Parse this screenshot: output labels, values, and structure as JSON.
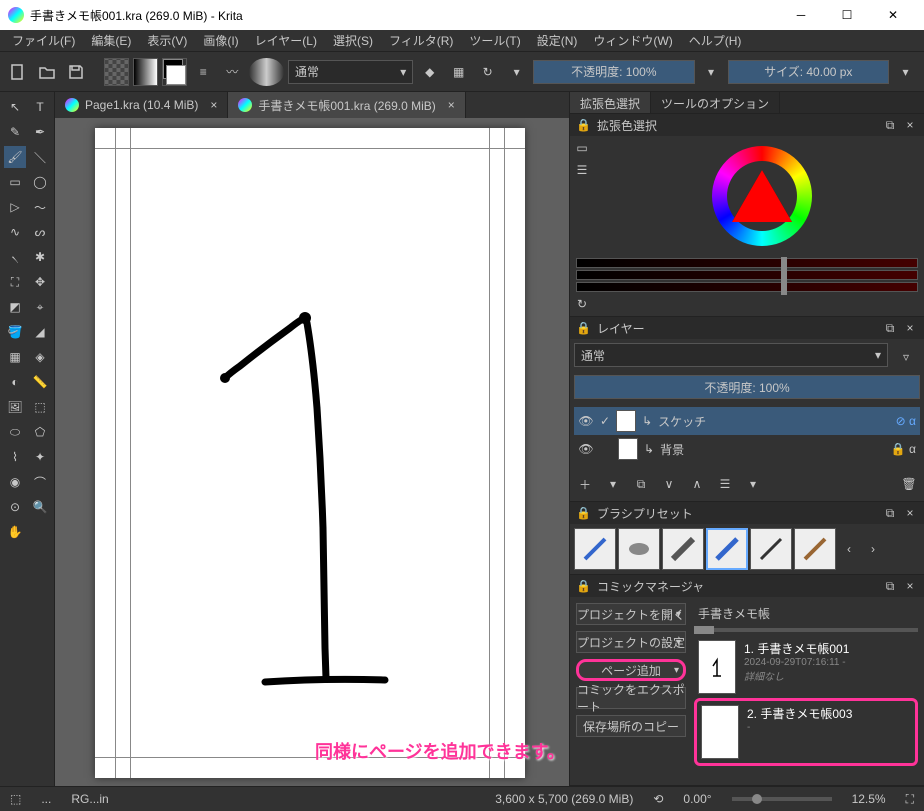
{
  "window": {
    "title": "手書きメモ帳001.kra (269.0 MiB)  - Krita"
  },
  "menu": {
    "file": "ファイル(F)",
    "edit": "編集(E)",
    "view": "表示(V)",
    "image": "画像(I)",
    "layer": "レイヤー(L)",
    "select": "選択(S)",
    "filter": "フィルタ(R)",
    "tool": "ツール(T)",
    "settings": "設定(N)",
    "window": "ウィンドウ(W)",
    "help": "ヘルプ(H)"
  },
  "toolbar": {
    "blend": "通常",
    "opacity": "不透明度: 100%",
    "size": "サイズ: 40.00 px"
  },
  "tabs": {
    "tab1": "Page1.kra (10.4 MiB)",
    "tab2": "手書きメモ帳001.kra (269.0 MiB)"
  },
  "panels": {
    "advcolor_tab": "拡張色選択",
    "toolopt_tab": "ツールのオプション",
    "advcolor_title": "拡張色選択",
    "layer_title": "レイヤー",
    "layer_blend": "通常",
    "layer_opacity": "不透明度: 100%",
    "layer1": "スケッチ",
    "layer2": "背景",
    "brush_title": "ブラシプリセット",
    "comic_title": "コミックマネージャ",
    "comic_open": "プロジェクトを開く",
    "comic_settings": "プロジェクトの設定",
    "comic_add": "ページ追加",
    "comic_export": "コミックをエクスポート",
    "comic_copy": "保存場所のコピー",
    "comic_proj": "手書きメモ帳",
    "page1_name": "1. 手書きメモ帳001",
    "page1_date": "2024-09-29T07:16:11 -",
    "page1_detail": "詳細なし",
    "page2_name": "2. 手書きメモ帳003",
    "page2_meta": " - "
  },
  "status": {
    "selector": "RG...in",
    "dims": "3,600 x 5,700 (269.0 MiB)",
    "angle": "0.00°",
    "zoom": "12.5%"
  },
  "annotation": {
    "text": "同様にページを追加できます。"
  }
}
